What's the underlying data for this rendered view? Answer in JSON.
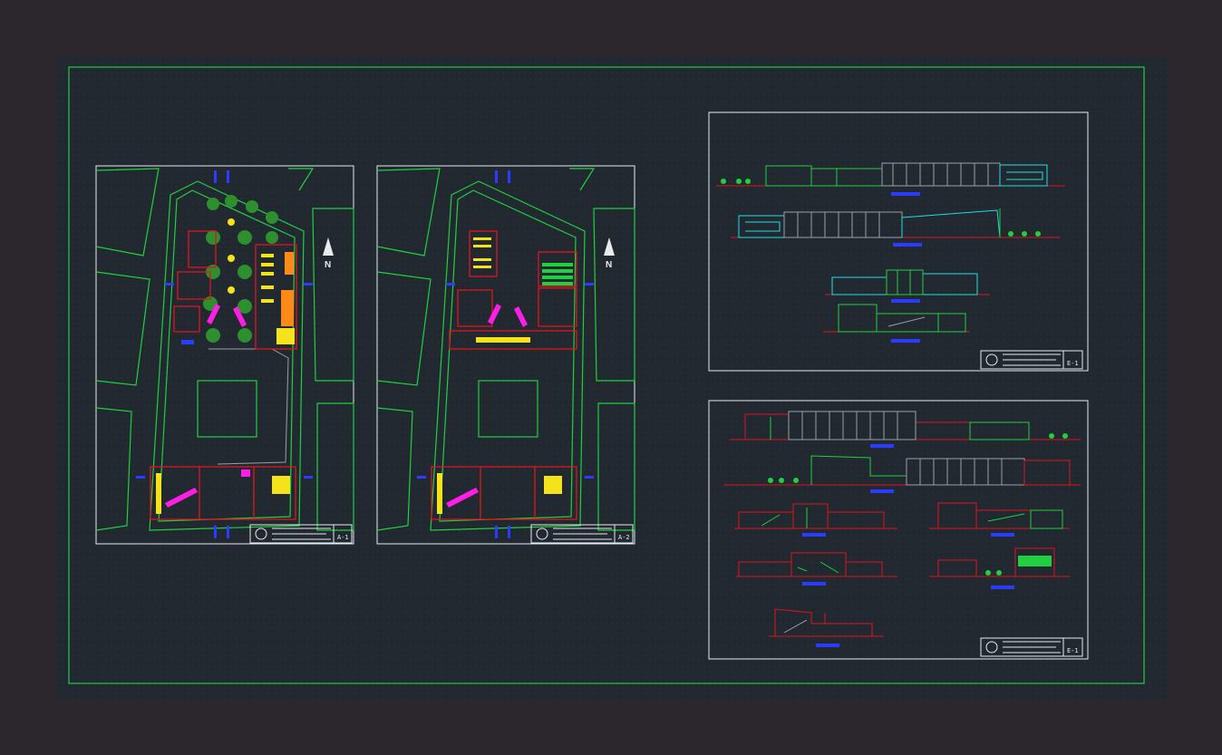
{
  "canvas": {
    "background": "#2b272d",
    "model_space": "#212830",
    "frame_color": "#22c94a"
  },
  "colors": {
    "white": "#e9ecef",
    "green": "#20d040",
    "red": "#e0141e",
    "yellow": "#f4e21a",
    "magenta": "#ff1ee6",
    "cyan": "#20e0e0",
    "blue": "#2a3cff",
    "orange": "#ff8a1a",
    "grey": "#9aa0a8"
  },
  "sheets": [
    {
      "id": "plan-1",
      "code": "A-1",
      "north_letter": "N"
    },
    {
      "id": "plan-2",
      "code": "A-2",
      "north_letter": "N"
    },
    {
      "id": "elevations",
      "code": "E-1"
    },
    {
      "id": "sections",
      "code": "E-1"
    }
  ],
  "icons": {
    "north_arrow": "north-arrow-icon",
    "logo": "stamp-logo-icon"
  }
}
